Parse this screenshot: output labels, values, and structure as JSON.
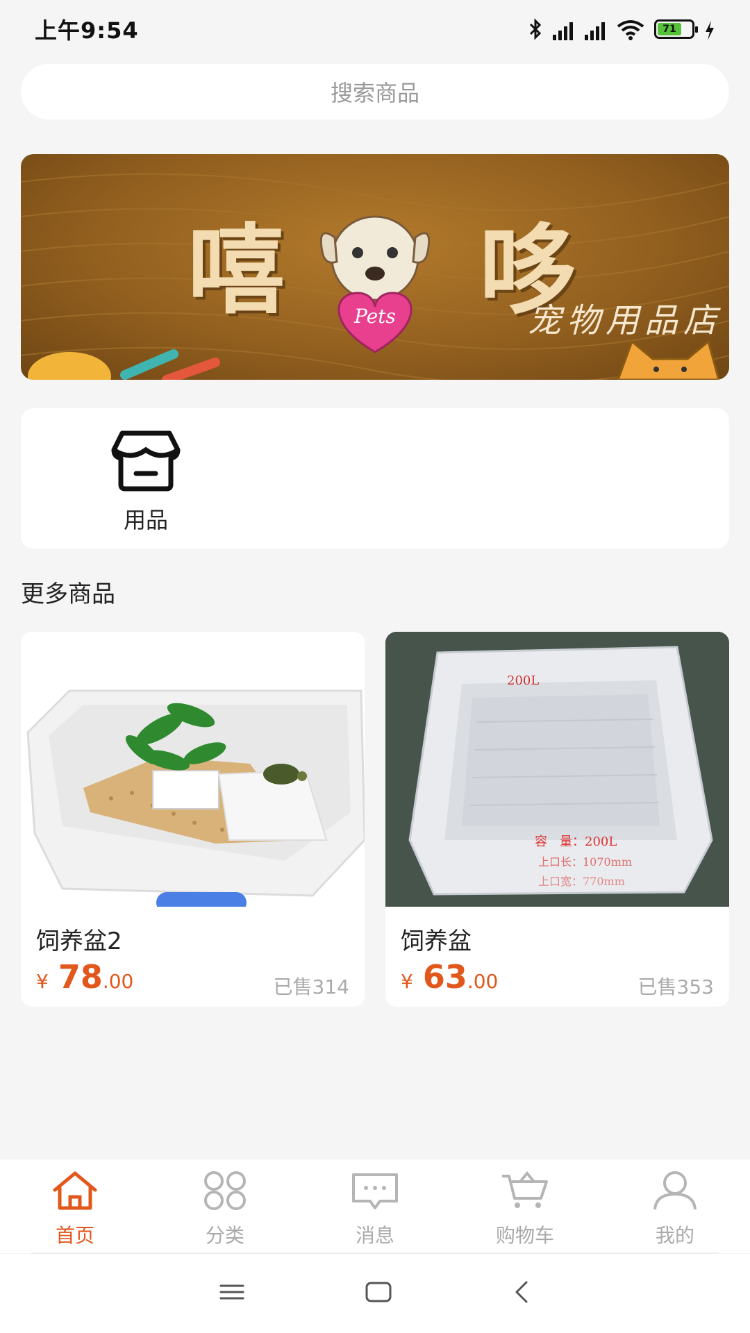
{
  "status": {
    "time": "上午9:54",
    "battery": "71",
    "icons": [
      "bluetooth-icon",
      "signal-hd-icon",
      "signal-hd-icon",
      "wifi-icon",
      "battery-icon",
      "charging-icon"
    ]
  },
  "search": {
    "placeholder": "搜索商品"
  },
  "banner": {
    "title_left": "嘻",
    "title_right": "哆",
    "badge": "Pets",
    "subtitle": "宠物用品店"
  },
  "categories": [
    {
      "label": "用品",
      "icon": "shop-box-icon"
    }
  ],
  "section_title": "更多商品",
  "products": [
    {
      "name": "饲养盆2",
      "currency": "¥",
      "price_int": "78",
      "price_dec": ".00",
      "sold": "已售314",
      "image": "turtle-tank-photo"
    },
    {
      "name": "饲养盆",
      "currency": "¥",
      "price_int": "63",
      "price_dec": ".00",
      "sold": "已售353",
      "image": "plastic-tub-photo",
      "image_text": {
        "tag": "200L",
        "line1": "容　量：200L",
        "line2": "上口长：1070mm",
        "line3": "上口宽：770mm"
      }
    }
  ],
  "tabs": [
    {
      "label": "首页",
      "icon": "home-icon",
      "active": true
    },
    {
      "label": "分类",
      "icon": "grid-icon",
      "active": false
    },
    {
      "label": "消息",
      "icon": "message-icon",
      "active": false
    },
    {
      "label": "购物车",
      "icon": "cart-icon",
      "active": false
    },
    {
      "label": "我的",
      "icon": "user-icon",
      "active": false
    }
  ],
  "colors": {
    "accent": "#e2571b",
    "inactive": "#aaaaaa",
    "background": "#f5f5f5"
  }
}
